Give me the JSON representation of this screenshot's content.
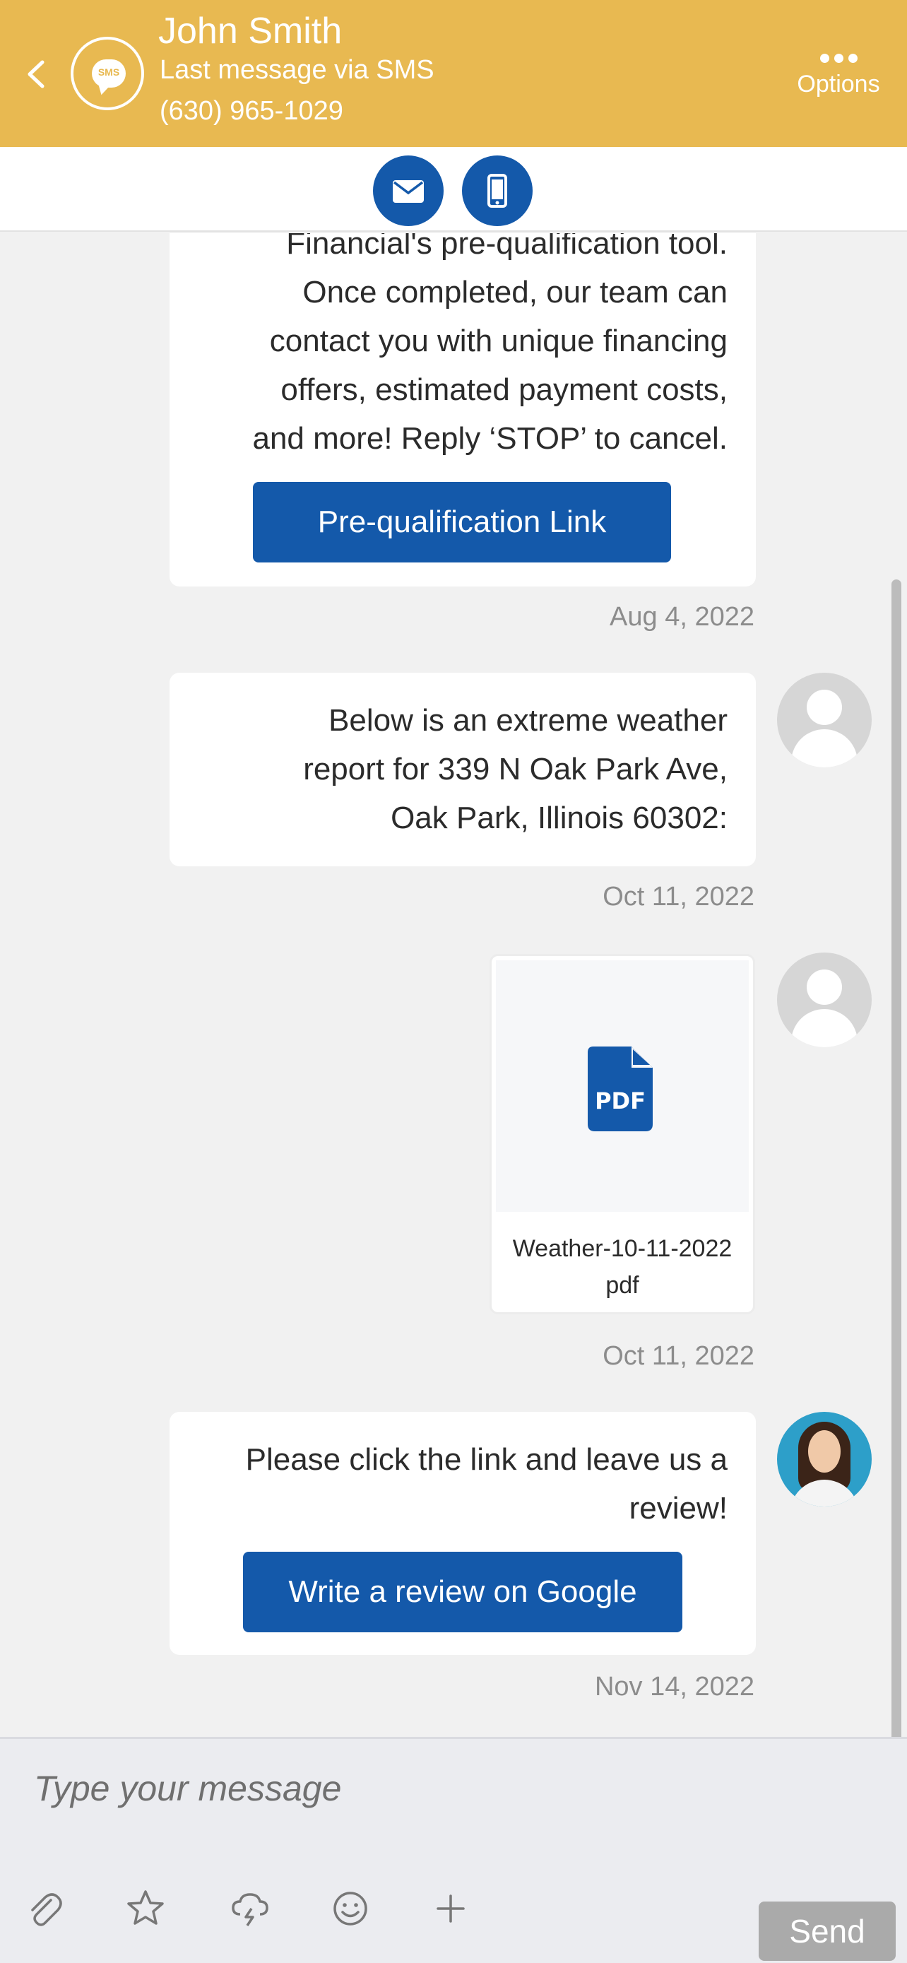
{
  "header": {
    "contact_name": "John Smith",
    "channel_note": "Last message via SMS",
    "phone": "(630) 965-1029",
    "options_label": "Options",
    "badge_text": "SMS",
    "icons": {
      "back": "chevron-left-icon",
      "badge": "sms-bubble-icon",
      "options": "ellipsis-icon"
    }
  },
  "channels": [
    {
      "name": "email",
      "icon": "envelope-icon"
    },
    {
      "name": "sms",
      "icon": "mobile-phone-icon"
    }
  ],
  "messages": [
    {
      "lines": [
        "Financial's pre-qualification tool.",
        "Once completed, our team can",
        "contact you with unique financing",
        "offers, estimated payment costs,",
        "and more! Reply ‘STOP’ to cancel."
      ],
      "button": "Pre-qualification Link",
      "timestamp": "Aug 4, 2022"
    },
    {
      "lines": [
        "Below is an extreme weather",
        "report for 339 N Oak Park Ave,",
        "Oak Park, Illinois 60302:"
      ],
      "timestamp": "Oct 11, 2022",
      "avatar": "default-user-avatar"
    },
    {
      "attachment": {
        "name": "Weather-10-11-2022",
        "ext": "pdf",
        "icon_text": "PDF",
        "icon": "pdf-file-icon"
      },
      "timestamp": "Oct 11, 2022",
      "avatar": "default-user-avatar"
    },
    {
      "lines": [
        "Please click the link and leave us a",
        "review!"
      ],
      "button": "Write a review on Google",
      "timestamp": "Nov 14, 2022",
      "avatar": "agent-photo-avatar"
    }
  ],
  "composer": {
    "placeholder": "Type your message",
    "send_label": "Send",
    "tools": [
      "paperclip-icon",
      "star-icon",
      "cloud-lightning-icon",
      "smiley-icon",
      "plus-icon"
    ]
  },
  "colors": {
    "header": "#e8b951",
    "primary": "#1459aa",
    "send_disabled": "#aaaaaa",
    "background": "#f1f1f1"
  }
}
